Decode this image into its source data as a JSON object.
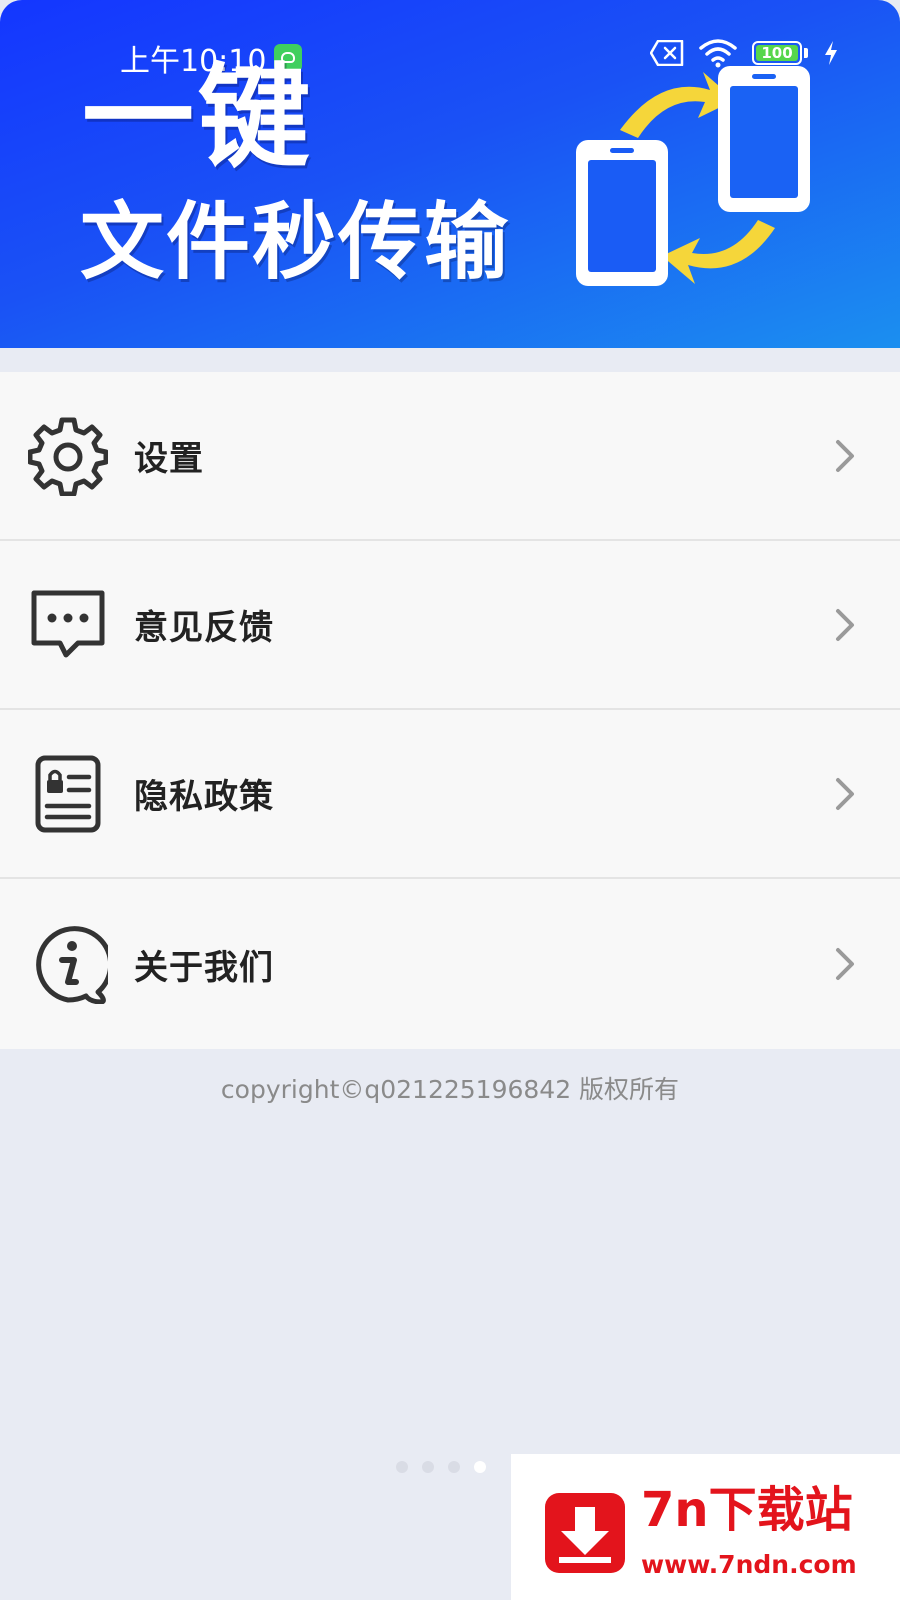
{
  "status_bar": {
    "time": "上午10:10",
    "battery": "100"
  },
  "banner": {
    "line1": "一键",
    "line2": "文件秒传输",
    "colors": {
      "start": "#1436ff",
      "end": "#1b8ff0",
      "arrow": "#f5d63a"
    }
  },
  "menu": {
    "items": [
      {
        "label": "设置",
        "icon": "gear-icon"
      },
      {
        "label": "意见反馈",
        "icon": "chat-bubble-icon"
      },
      {
        "label": "隐私政策",
        "icon": "privacy-card-icon"
      },
      {
        "label": "关于我们",
        "icon": "info-icon"
      }
    ]
  },
  "footer": {
    "copyright": "copyright©q021225196842 版权所有"
  },
  "watermark": {
    "title": "7n下载站",
    "url": "www.7ndn.com",
    "color": "#e3141c"
  }
}
